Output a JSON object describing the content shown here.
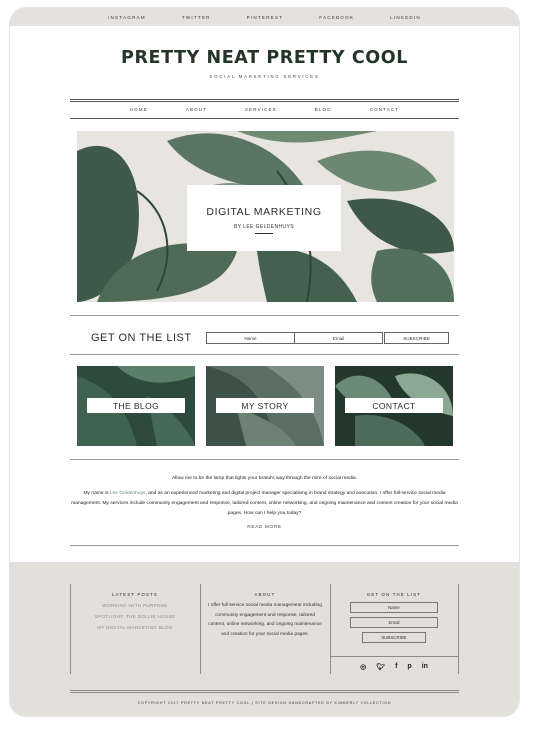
{
  "topbar": {
    "links": [
      "INSTAGRAM",
      "TWITTER",
      "PINTEREST",
      "FACEBOOK",
      "LINKEDIN"
    ]
  },
  "brand": {
    "title": "PRETTY NEAT PRETTY COOL",
    "tagline": "SOCIAL MARKETING SERVICES"
  },
  "nav": {
    "items": [
      "HOME",
      "ABOUT",
      "SERVICES",
      "BLOG",
      "CONTACT"
    ]
  },
  "hero": {
    "heading": "DIGITAL MARKETING",
    "byline": "BY LEE GELDENHUYS"
  },
  "signup": {
    "label": "GET ON THE LIST",
    "name_placeholder": "Name",
    "email_placeholder": "Email",
    "button": "SUBSCRIBE"
  },
  "tiles": [
    "THE BLOG",
    "MY STORY",
    "CONTACT"
  ],
  "intro": {
    "lead": "Allow me to be the lamp that lights your brand's way through the mire of social media.",
    "body_prefix": "My name is ",
    "name_link": "Lee Geldenhuys",
    "body_suffix": ", and as an experienced marketing and digital project manager specialising in brand strategy and execution, I offer full-service social media management. My services include community engagement and response, tailored content, online networking, and ongoing maintenance and content creation for your social media pages. How can I help you today?",
    "read_more": "READ MORE"
  },
  "footer": {
    "latest_posts": {
      "heading": "LATEST POSTS",
      "posts": [
        "WORKING WITH PURPOSE",
        "SPOTLIGHT: THE DOLLIE HOUSE",
        "MY DIGITAL MARKETING BLOG"
      ]
    },
    "about": {
      "heading": "ABOUT",
      "text": "I offer full service social media management including community engagement and response, tailored content, online networking, and ongoing maintenance and creation for your social media pages."
    },
    "list": {
      "heading": "GET ON THE LIST",
      "name_placeholder": "Name",
      "email_placeholder": "Email",
      "button": "SUBSCRIBE"
    },
    "social_icons": [
      "instagram-icon",
      "twitter-icon",
      "facebook-icon",
      "pinterest-icon",
      "linkedin-icon"
    ],
    "copyright": "COPYRIGHT 2017 PRETTY NEAT PRETTY COOL | SITE DESIGN HANDCRAFTED BY KIMBERLY VOLLECTION"
  },
  "colors": {
    "brand_green": "#243428",
    "footer_bg": "#e3e0dc",
    "link": "#6b8a7d"
  }
}
